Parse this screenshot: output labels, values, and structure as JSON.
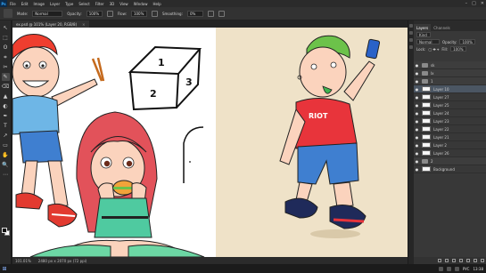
{
  "app": {
    "logo": "Ps"
  },
  "menu": [
    "File",
    "Edit",
    "Image",
    "Layer",
    "Type",
    "Select",
    "Filter",
    "3D",
    "View",
    "Window",
    "Help"
  ],
  "window_controls": [
    "–",
    "□",
    "✕"
  ],
  "options": {
    "mode_label": "Mode:",
    "mode_value": "Normal",
    "opacity_label": "Opacity:",
    "opacity_value": "100%",
    "flow_label": "Flow:",
    "flow_value": "100%",
    "smoothing_label": "Smoothing:",
    "smoothing_value": "0%"
  },
  "tools": [
    "↖",
    "⬚",
    "ʘ",
    "⌗",
    "✂",
    "✎",
    "⌫",
    "▲",
    "◐",
    "✒",
    "T",
    "↗",
    "▭",
    "✋",
    "🔍",
    "⋯"
  ],
  "document": {
    "tab_label": "ex.psd @ 101% (Layer 20, RGB/8)",
    "close": "×"
  },
  "status": {
    "zoom": "101.01%",
    "size": "2480 px x 2070 px (72 ppi)"
  },
  "panels": {
    "tabs": [
      "Layers",
      "Channels"
    ]
  },
  "layers_panel": {
    "kind_label": "Kind",
    "blend_mode": "Normal",
    "opacity_label": "Opacity:",
    "opacity_value": "100%",
    "lock_label": "Lock:",
    "fill_label": "Fill:",
    "fill_value": "100%",
    "layers": [
      {
        "name": "sk",
        "type": "group"
      },
      {
        "name": "lx",
        "type": "group"
      },
      {
        "name": "1",
        "type": "group"
      },
      {
        "name": "Layer 10",
        "type": "layer",
        "selected": true
      },
      {
        "name": "Layer 27",
        "type": "layer"
      },
      {
        "name": "Layer 25",
        "type": "layer"
      },
      {
        "name": "Layer 24",
        "type": "layer"
      },
      {
        "name": "Layer 23",
        "type": "layer"
      },
      {
        "name": "Layer 22",
        "type": "layer"
      },
      {
        "name": "Layer 21",
        "type": "layer"
      },
      {
        "name": "Layer 2",
        "type": "layer"
      },
      {
        "name": "Layer 26",
        "type": "layer"
      },
      {
        "name": "2",
        "type": "group"
      },
      {
        "name": "Background",
        "type": "layer"
      }
    ]
  },
  "artwork": {
    "box_numbers": [
      "1",
      "2",
      "3"
    ],
    "shirt_text": "RIOT",
    "colors": {
      "left_bg": "#ffffff",
      "right_bg": "#efe2c8",
      "shirt": "#e8343b",
      "hair": "#ef3e2f",
      "green_hair": "#6cc24a"
    }
  },
  "taskbar": {
    "time": "13:38",
    "lang": "РУС"
  }
}
